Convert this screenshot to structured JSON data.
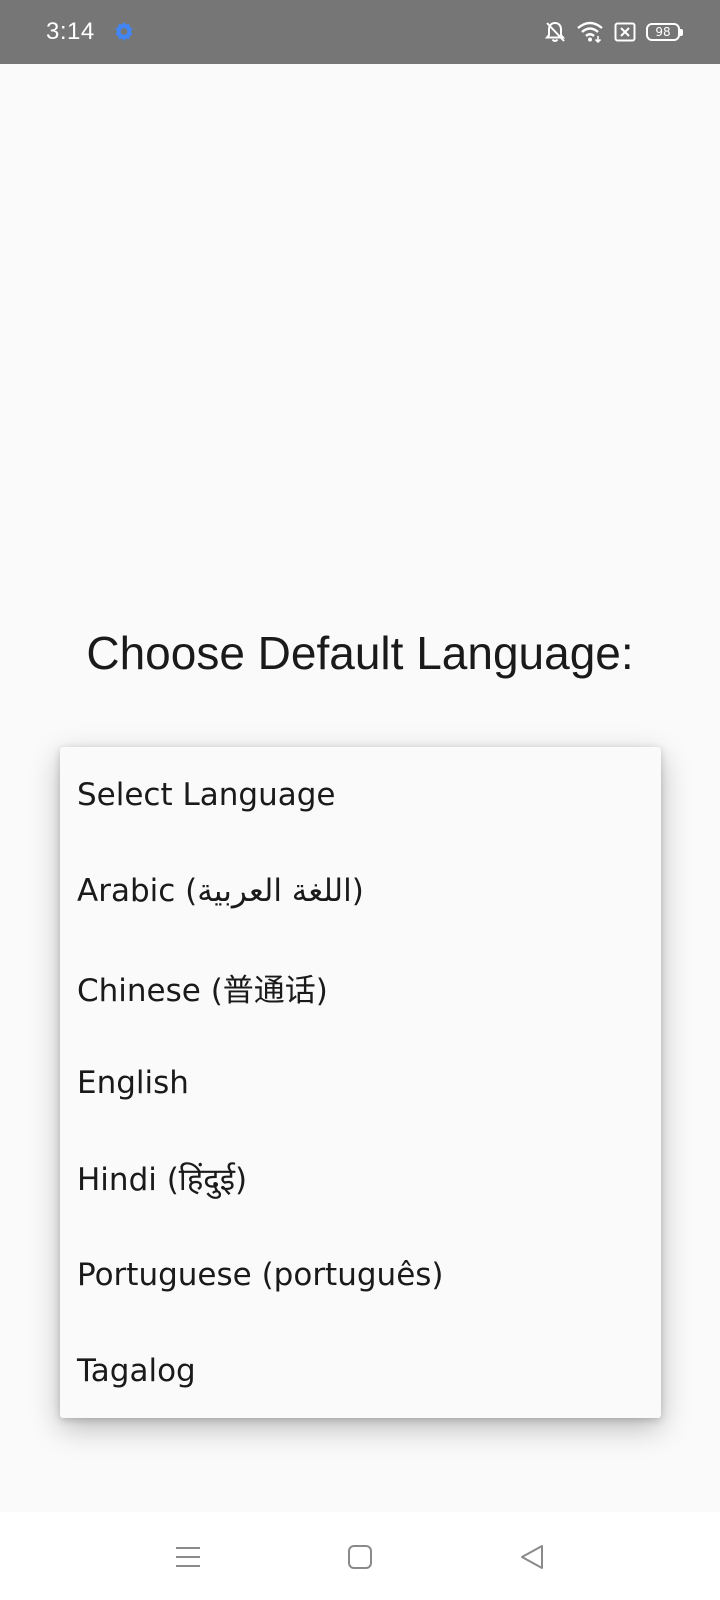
{
  "status_bar": {
    "time": "3:14",
    "battery_level": "98",
    "icons": [
      "gear-icon",
      "bell-off-icon",
      "wifi-icon",
      "no-sim-icon",
      "battery-icon"
    ],
    "accent_color": "#4285f4"
  },
  "title": "Choose Default Language:",
  "dropdown": {
    "items": [
      {
        "label": "Select Language"
      },
      {
        "label": "Arabic (اللغة العربية)"
      },
      {
        "label": "Chinese (普通话)"
      },
      {
        "label": "English"
      },
      {
        "label": "Hindi (हिंदुई)"
      },
      {
        "label": "Portuguese (português)"
      },
      {
        "label": "Tagalog"
      }
    ]
  },
  "nav_bar": {
    "icons": [
      "menu-icon",
      "home-icon",
      "back-icon"
    ]
  }
}
